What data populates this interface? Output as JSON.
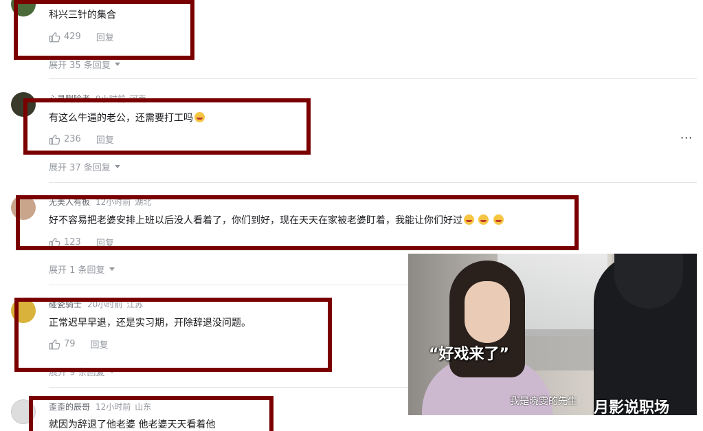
{
  "comments": [
    {
      "username": "",
      "time": "",
      "location": "",
      "text": "科兴三针的集合",
      "likes": "429",
      "reply_label": "回复",
      "expand_label": "展开 35 条回复",
      "avatar_color": "#4a6a3a"
    },
    {
      "username": "心灵删除者",
      "time": "9小时前",
      "location": "河南",
      "text": "有这么牛逼的老公，还需要打工吗",
      "likes": "236",
      "reply_label": "回复",
      "expand_label": "展开 37 条回复",
      "avatar_color": "#3a3a2a"
    },
    {
      "username": "无美人有板",
      "time": "12小时前",
      "location": "湖北",
      "text": "好不容易把老婆安排上班以后没人看着了，你们到好，现在天天在家被老婆盯着，我能让你们好过",
      "likes": "123",
      "reply_label": "回复",
      "expand_label": "展开 1 条回复",
      "avatar_color": "#c9a58c"
    },
    {
      "username": "碰瓷骑士",
      "time": "20小时前",
      "location": "江苏",
      "text": "正常迟早早退，还是实习期，开除辞退没问题。",
      "likes": "79",
      "reply_label": "回复",
      "expand_label": "展开 9 条回复",
      "avatar_color": "#d8b23a"
    },
    {
      "username": "歪歪的辰哥",
      "time": "12小时前",
      "location": "山东",
      "text": "就因为辞退了他老婆 他老婆天天看着他",
      "avatar_color": "#dddddd"
    }
  ],
  "more_label": "···",
  "video": {
    "caption_big": "“好戏来了”",
    "caption": "我是晓雯的先生",
    "brand": "月影说职场"
  },
  "colors": {
    "highlight": "#7a0000",
    "muted": "#9499a0"
  }
}
